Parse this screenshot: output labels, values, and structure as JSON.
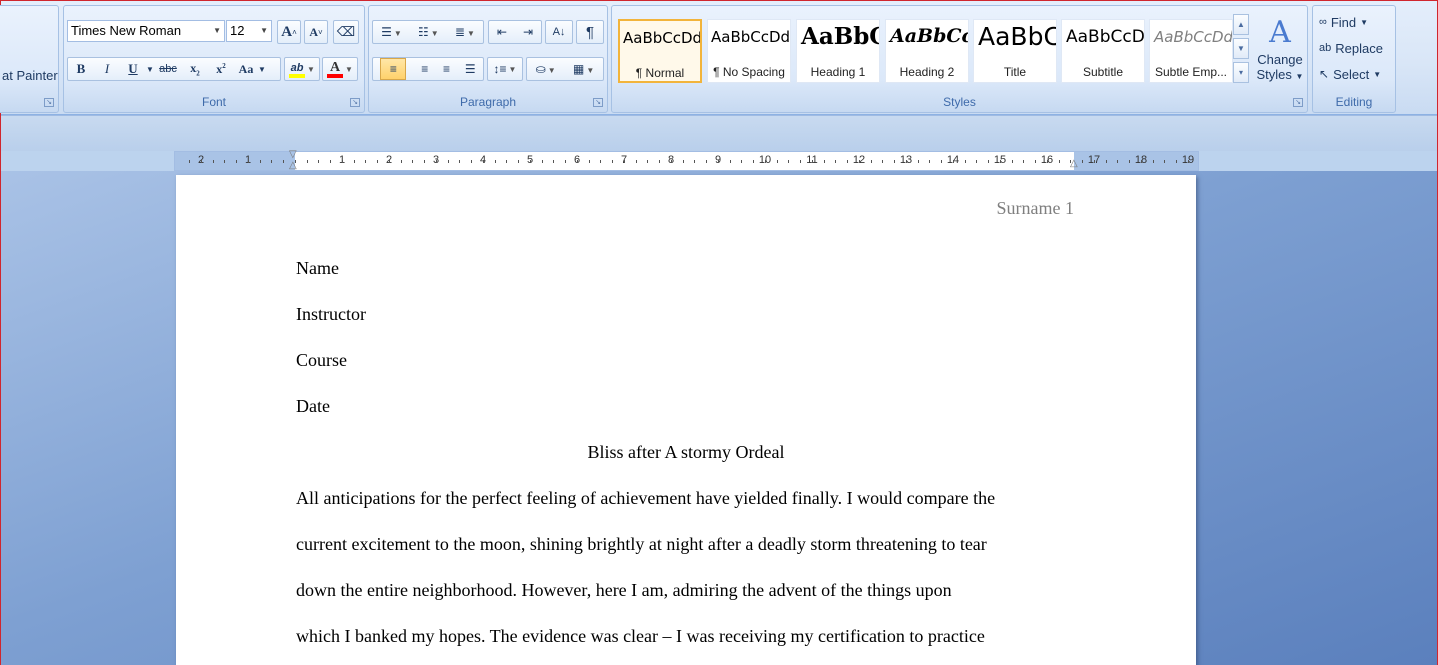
{
  "clipboard": {
    "format_painter_label": "at Painter"
  },
  "font": {
    "group_label": "Font",
    "font_name": "Times New Roman",
    "font_size": "12",
    "grow_label": "A",
    "shrink_label": "A",
    "bold": "B",
    "italic": "I",
    "underline": "U",
    "strike": "abc",
    "subscript": "x",
    "superscript": "x",
    "case": "Aa",
    "highlight": "ab",
    "font_color": "A"
  },
  "paragraph": {
    "group_label": "Paragraph",
    "pilcrow": "¶"
  },
  "styles": {
    "group_label": "Styles",
    "items": [
      {
        "sample": "AaBbCcDd",
        "name": "¶ Normal"
      },
      {
        "sample": "AaBbCcDd",
        "name": "¶ No Spacing"
      },
      {
        "sample": "AaBbC",
        "name": "Heading 1"
      },
      {
        "sample": "AaBbCc",
        "name": "Heading 2"
      },
      {
        "sample": "AaBbC",
        "name": "Title"
      },
      {
        "sample": "AaBbCcD",
        "name": "Subtitle"
      },
      {
        "sample": "AaBbCcDd",
        "name": "Subtle Emp..."
      }
    ],
    "change_styles_line1": "Change",
    "change_styles_line2": "Styles"
  },
  "editing": {
    "group_label": "Editing",
    "find": "Find",
    "replace": "Replace",
    "select": "Select"
  },
  "ruler": {
    "left_numbers": [
      "2",
      "1"
    ],
    "right_numbers": [
      "1",
      "2",
      "3",
      "4",
      "5",
      "6",
      "7",
      "8",
      "9",
      "10",
      "11",
      "12",
      "13",
      "14",
      "15",
      "16",
      "17",
      "18",
      "19"
    ]
  },
  "document": {
    "header": "Surname 1",
    "lines": [
      "Name",
      "Instructor",
      "Course",
      "Date"
    ],
    "title": "Bliss after A stormy Ordeal",
    "body": [
      "All anticipations for the perfect feeling of achievement have yielded finally. I would compare the",
      "current excitement to the moon, shining brightly at night after a deadly storm threatening to tear",
      "down the entire neighborhood. However, here I am, admiring the advent of the things upon",
      "which I banked my hopes. The evidence was clear – I was receiving my certification to practice"
    ]
  },
  "colors": {
    "highlight": "#ffff00",
    "font_color": "#ff0000",
    "selected_style_border": "#f2b43b"
  }
}
